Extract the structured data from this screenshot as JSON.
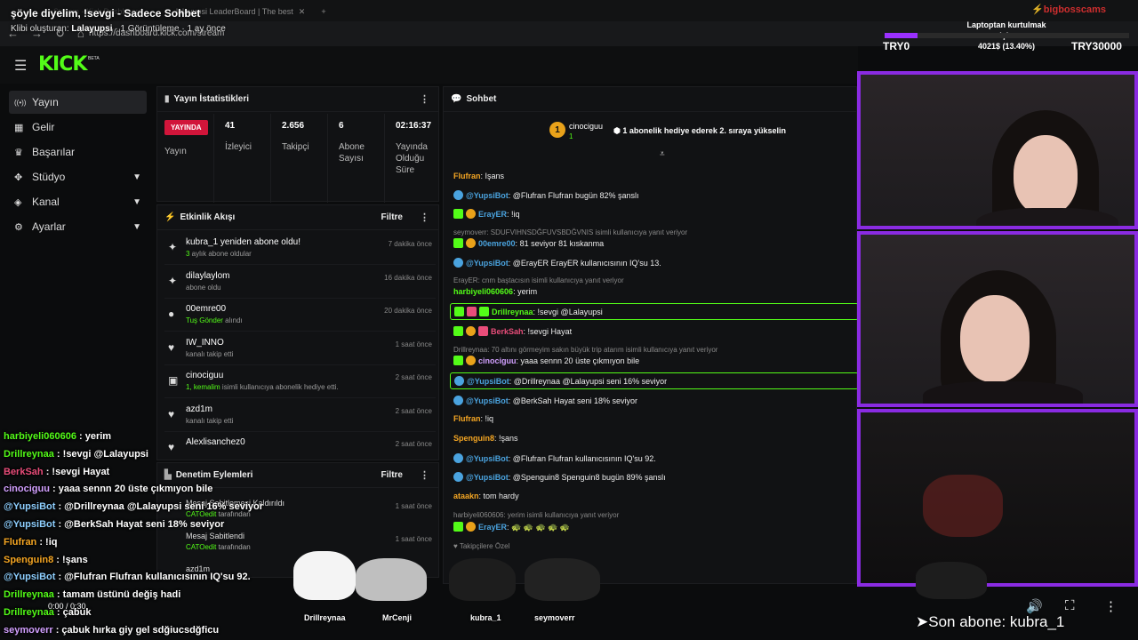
{
  "browser": {
    "tab1": "Stream - Kick Dashboard",
    "tab2": "lalayupsi LeaderBoard | The best",
    "url": "https://dashboard.kick.com/stream"
  },
  "clip": {
    "title": "şöyle diyelim, !sevgi - Sadece Sohbet",
    "creator_label": "Klibi oluşturan:",
    "creator": "Lalayupsi",
    "meta": "· 1 Görüntüleme · 1 ay önce"
  },
  "header": {
    "logo": "KICK",
    "beta": "BETA"
  },
  "sidebar": {
    "items": [
      {
        "label": "Yayın",
        "icon": "broadcast-icon",
        "glyph": "((•))",
        "active": true
      },
      {
        "label": "Gelir",
        "icon": "revenue-icon",
        "glyph": "▦"
      },
      {
        "label": "Başarılar",
        "icon": "trophy-icon",
        "glyph": "♛"
      },
      {
        "label": "Stüdyo",
        "icon": "studio-icon",
        "glyph": "✥",
        "expandable": true
      },
      {
        "label": "Kanal",
        "icon": "channel-icon",
        "glyph": "◈",
        "expandable": true
      },
      {
        "label": "Ayarlar",
        "icon": "settings-icon",
        "glyph": "⚙",
        "expandable": true
      }
    ]
  },
  "stats": {
    "title": "Yayın İstatistikleri",
    "live": "YAYINDA",
    "live_label": "Yayın",
    "viewers": "41",
    "viewers_label": "İzleyici",
    "followers": "2.656",
    "followers_label": "Takipçi",
    "subs": "6",
    "subs_label": "Abone Sayısı",
    "uptime": "02:16:37",
    "uptime_label": "Yayında Olduğu Süre"
  },
  "activity": {
    "title": "Etkinlik Akışı",
    "filter": "Filtre",
    "items": [
      {
        "name": "kubra_1 yeniden abone oldu!",
        "sub_green": "3",
        "sub": " aylık abone oldular",
        "time": "7 dakika önce",
        "icon": "sparkle-icon",
        "glyph": "✦"
      },
      {
        "name": "dilaylaylom",
        "sub_green": "",
        "sub": "abone oldu",
        "time": "16 dakika önce",
        "icon": "sparkle-icon",
        "glyph": "✦"
      },
      {
        "name": "00emre00",
        "sub_green": "Tuş Gönder",
        "sub": " alındı",
        "time": "20 dakika önce",
        "icon": "reward-icon",
        "glyph": "●"
      },
      {
        "name": "IW_INNO",
        "sub_green": "",
        "sub": "kanalı takip etti",
        "time": "1 saat önce",
        "icon": "heart-icon",
        "glyph": "♥"
      },
      {
        "name": "cinociguu",
        "sub_green": "1, kemalim",
        "sub": " isimli kullanıcıya abonelik hediye etti.",
        "time": "2 saat önce",
        "icon": "gift-icon",
        "glyph": "▣"
      },
      {
        "name": "azd1m",
        "sub_green": "",
        "sub": "kanalı takip etti",
        "time": "2 saat önce",
        "icon": "heart-icon",
        "glyph": "♥"
      },
      {
        "name": "Alexlisanchez0",
        "sub_green": "",
        "sub": "",
        "time": "2 saat önce",
        "icon": "heart-icon",
        "glyph": "♥"
      }
    ]
  },
  "moderation": {
    "title": "Denetim Eylemleri",
    "filter": "Filtre",
    "items": [
      {
        "name": "Mesaj Sabitlemesi Kaldırıldı",
        "sub_green": "CATOedit",
        "sub": " tarafından",
        "time": "1 saat önce"
      },
      {
        "name": "Mesaj Sabitlendi",
        "sub_green": "CATOedit",
        "sub": " tarafından",
        "time": "1 saat önce"
      },
      {
        "name": "azd1m",
        "sub_green": "",
        "sub": "",
        "time": ""
      }
    ]
  },
  "chat": {
    "title": "Sohbet",
    "pinned": {
      "badge": "1",
      "user": "cinociguu",
      "count": "1",
      "text": "1 abonelik hediye ederek 2. sıraya yükselin"
    },
    "footer": "♥ Takipçilere Özel",
    "messages": [
      {
        "user": "Flufran",
        "color": "#f5a623",
        "text": "Işans",
        "badges": []
      },
      {
        "user": "@YupsiBot",
        "color": "#4aa3df",
        "text": "@Flufran Flufran bugün 82% şanslı",
        "badges": [
          "bot"
        ]
      },
      {
        "user": "ErayER",
        "color": "#4aa3df",
        "text": "!iq",
        "badges": [
          "mod",
          "sub"
        ]
      },
      {
        "reply": "seymoverr: SDUFVIHNSDĞFUVSBDĞVNIS isimli kullanıcıya yanıt veriyor"
      },
      {
        "user": "00emre00",
        "color": "#4aa3df",
        "text": "81 seviyor 81 kıskanma",
        "badges": [
          "mod",
          "sub"
        ]
      },
      {
        "user": "@YupsiBot",
        "color": "#4aa3df",
        "text": "@ErayER ErayER kullanıcısının IQ'su 13.",
        "badges": [
          "bot"
        ]
      },
      {
        "reply": "ErayER: cnm baştacısın isimli kullanıcıya yanıt veriyor"
      },
      {
        "user": "harbiyeli060606",
        "color": "#53fc18",
        "text": "yerim",
        "badges": []
      },
      {
        "user": "Drillreynaa",
        "color": "#53fc18",
        "text": "!sevgi @Lalayupsi",
        "badges": [
          "mod",
          "vip",
          "mod"
        ],
        "highlight": true
      },
      {
        "user": "BerkSah",
        "color": "#e94d7a",
        "text": "!sevgi Hayat",
        "badges": [
          "mod",
          "sub",
          "vip"
        ]
      },
      {
        "reply": "Drillreynaa: 70 altını görmeyim sakın büyük trip atarım isimli kullanıcıya yanıt veriyor"
      },
      {
        "user": "cinociguu",
        "color": "#d2a0ff",
        "text": "yaaa sennn 20 üste çıkmıyon bile",
        "badges": [
          "mod",
          "sub"
        ]
      },
      {
        "user": "@YupsiBot",
        "color": "#4aa3df",
        "text": "@Drillreynaa @Lalayupsi seni 16% seviyor",
        "badges": [
          "bot"
        ],
        "highlight": true
      },
      {
        "user": "@YupsiBot",
        "color": "#4aa3df",
        "text": "@BerkSah Hayat seni 18% seviyor",
        "badges": [
          "bot"
        ]
      },
      {
        "user": "Flufran",
        "color": "#f5a623",
        "text": "!iq",
        "badges": []
      },
      {
        "user": "Spenguin8",
        "color": "#f5a623",
        "text": "!şans",
        "badges": []
      },
      {
        "user": "@YupsiBot",
        "color": "#4aa3df",
        "text": "@Flufran Flufran kullanıcısının IQ'su 92.",
        "badges": [
          "bot"
        ]
      },
      {
        "user": "@YupsiBot",
        "color": "#4aa3df",
        "text": "@Spenguin8 Spenguin8 bugün 89% şanslı",
        "badges": [
          "bot"
        ]
      },
      {
        "user": "ataakn",
        "color": "#f5a623",
        "text": "tom hardy",
        "badges": []
      },
      {
        "reply": "harbiyeli060606: yerim isimli kullanıcıya yanıt veriyor"
      },
      {
        "user": "ErayER",
        "color": "#4aa3df",
        "text": "🐢 🐢 🐢 🐢 🐢",
        "badges": [
          "mod",
          "sub"
        ]
      }
    ]
  },
  "goal": {
    "label": "Laptoptan kurtulmak için",
    "progress_text": "4021$ (13.40%)",
    "progress": 0.134,
    "start": "TRY0",
    "end": "TRY30000"
  },
  "overlay_chat": [
    {
      "user": "harbiyeli060606",
      "color": "#53fc18",
      "text": " : yerim"
    },
    {
      "user": "Drillreynaa",
      "color": "#53fc18",
      "text": " : !sevgi @Lalayupsi"
    },
    {
      "user": "BerkSah",
      "color": "#e94d7a",
      "text": " : !sevgi Hayat"
    },
    {
      "user": "cinociguu",
      "color": "#d2a0ff",
      "text": " : yaaa sennn 20 üste çıkmıyon bile"
    },
    {
      "user": "@YupsiBot",
      "color": "#8ecfff",
      "text": " : @Drillreynaa @Lalayupsi seni 16% seviyor"
    },
    {
      "user": "@YupsiBot",
      "color": "#8ecfff",
      "text": " : @BerkSah Hayat seni 18% seviyor"
    },
    {
      "user": "Flufran",
      "color": "#f5a623",
      "text": " : !iq"
    },
    {
      "user": "Spenguin8",
      "color": "#f5a623",
      "text": " : !şans"
    },
    {
      "user": "@YupsiBot",
      "color": "#8ecfff",
      "text": " : @Flufran Flufran kullanıcısının IQ'su 92."
    },
    {
      "user": "Drillreynaa",
      "color": "#53fc18",
      "text": " : tamam üstünü değiş hadi"
    },
    {
      "user": "Drillreynaa",
      "color": "#53fc18",
      "text": " : çabuk"
    },
    {
      "user": "seymoverr",
      "color": "#d2a0ff",
      "text": " : çabuk hırka giy gel sdğiucsdğficu"
    }
  ],
  "cats": [
    "Drillreynaa",
    "MrCenji",
    "kubra_1",
    "seymoverr"
  ],
  "player": {
    "time": "0:00 / 0:30",
    "last_sub": "➤Son abone: kubra_1"
  },
  "colors": {
    "kick_green": "#53fc18",
    "cam_border": "#8a2be2",
    "live_red": "#d1153a"
  }
}
